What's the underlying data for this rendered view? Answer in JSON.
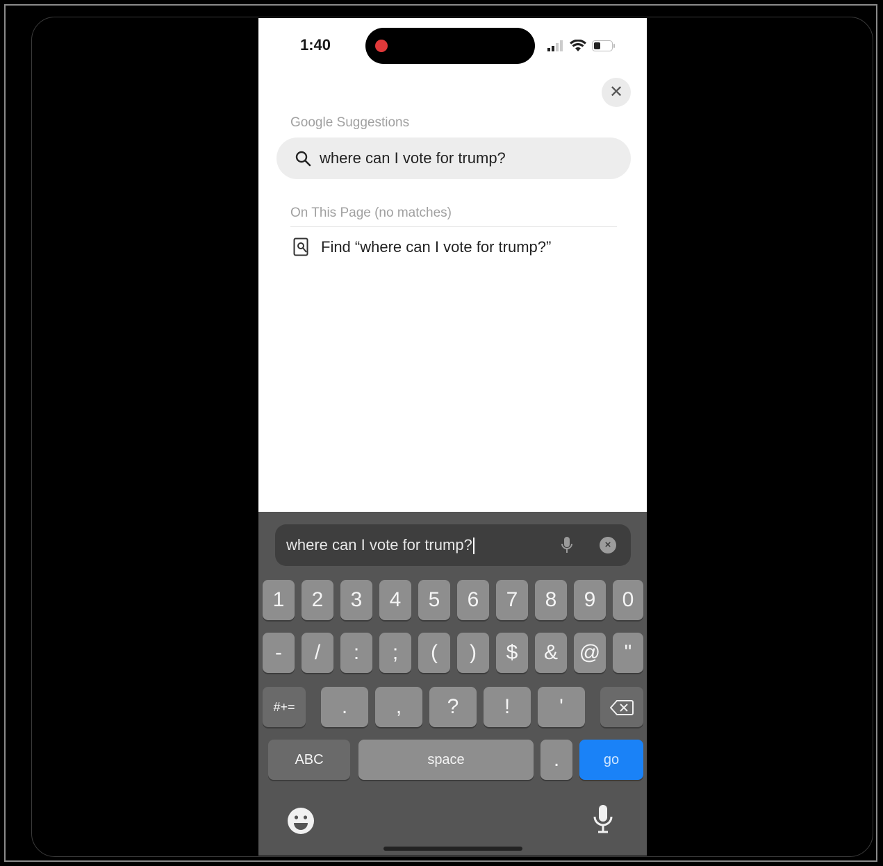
{
  "status_bar": {
    "time": "1:40"
  },
  "search_panel": {
    "close_label": "✕",
    "google_header": "Google Suggestions",
    "suggestion_text": "where can I vote for trump?",
    "on_page_header": "On This Page (no matches)",
    "find_text": "Find “where can I vote for trump?”"
  },
  "keyboard": {
    "input_value": "where can I vote for trump?",
    "row1": [
      "1",
      "2",
      "3",
      "4",
      "5",
      "6",
      "7",
      "8",
      "9",
      "0"
    ],
    "row2": [
      "-",
      "/",
      ":",
      ";",
      "(",
      ")",
      "$",
      "&",
      "@",
      "\""
    ],
    "row3_mode": "#+=",
    "row3": [
      ".",
      ",",
      "?",
      "!",
      "'"
    ],
    "abc_label": "ABC",
    "space_label": "space",
    "period_label": ".",
    "go_label": "go"
  },
  "colors": {
    "go_key": "#1a82f7",
    "keyboard_bg": "#555555",
    "record_dot": "#e0393a"
  }
}
